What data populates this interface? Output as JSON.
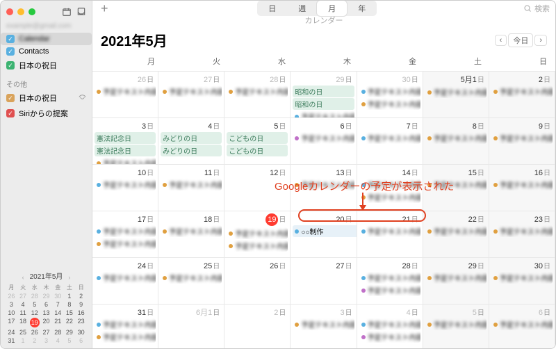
{
  "sidebar": {
    "account_blur": "example@gmail.com",
    "calendars": [
      {
        "name": "",
        "color": "#59b0e0",
        "checked": true,
        "selected": true,
        "blur": true
      },
      {
        "name": "Contacts",
        "color": "#59b0e0",
        "checked": true
      },
      {
        "name": "日本の祝日",
        "color": "#3cb371",
        "checked": true
      }
    ],
    "other_label": "その他",
    "other": [
      {
        "name": "日本の祝日",
        "color": "#d9a35b",
        "checked": true,
        "shared": true
      },
      {
        "name": "Siriからの提案",
        "color": "#e05050",
        "checked": true
      }
    ]
  },
  "toolbar": {
    "segments": [
      "日",
      "週",
      "月",
      "年"
    ],
    "active": 2,
    "search_placeholder": "検索",
    "calendar_label": "カレンダー"
  },
  "header": {
    "month_label": "2021年5月",
    "today_label": "今日"
  },
  "dow": [
    "月",
    "火",
    "水",
    "木",
    "金",
    "土",
    "日"
  ],
  "weeks": [
    [
      {
        "d": "26",
        "sfx": "日",
        "off": true,
        "events": [
          {
            "blur": true,
            "dot": "#e0a040",
            "time": "14:10"
          }
        ]
      },
      {
        "d": "27",
        "sfx": "日",
        "off": true,
        "events": [
          {
            "blur": true,
            "dot": "#e0a040",
            "time": "11:30"
          }
        ]
      },
      {
        "d": "28",
        "sfx": "日",
        "off": true,
        "events": [
          {
            "blur": true,
            "dot": "#e0a040",
            "time": "13:00"
          }
        ]
      },
      {
        "d": "29",
        "sfx": "日",
        "off": true,
        "events": [
          {
            "banner": true,
            "text": "昭和の日"
          },
          {
            "banner": true,
            "text": "昭和の日"
          },
          {
            "blur": true,
            "dot": "#59b0e0",
            "time": "9:00"
          },
          {
            "blur": true,
            "dot": "#e0a040",
            "time": "16:00"
          }
        ]
      },
      {
        "d": "30",
        "sfx": "日",
        "off": true,
        "events": [
          {
            "blur": true,
            "dot": "#59b0e0",
            "time": "14:10"
          },
          {
            "blur": true,
            "dot": "#e0a040",
            "time": "19:00"
          }
        ]
      },
      {
        "d": "5月1",
        "sfx": "日",
        "off": false,
        "events": [
          {
            "blur": true,
            "dot": "#e0a040",
            "time": "19:00"
          }
        ]
      },
      {
        "d": "2",
        "sfx": "日",
        "off": false,
        "events": [
          {
            "blur": true,
            "dot": "#e0a040",
            "time": "19:00"
          }
        ]
      }
    ],
    [
      {
        "d": "3",
        "sfx": "日",
        "events": [
          {
            "banner": true,
            "text": "憲法記念日"
          },
          {
            "banner": true,
            "text": "憲法記念日"
          },
          {
            "blur": true,
            "dot": "#e0a040",
            "time": "11:30"
          }
        ]
      },
      {
        "d": "4",
        "sfx": "日",
        "events": [
          {
            "banner": true,
            "text": "みどりの日"
          },
          {
            "banner": true,
            "text": "みどりの日"
          }
        ]
      },
      {
        "d": "5",
        "sfx": "日",
        "events": [
          {
            "banner": true,
            "text": "こどもの日"
          },
          {
            "banner": true,
            "text": "こどもの日"
          }
        ]
      },
      {
        "d": "6",
        "sfx": "日",
        "events": [
          {
            "blur": true,
            "dot": "#c070c8"
          }
        ]
      },
      {
        "d": "7",
        "sfx": "日",
        "events": [
          {
            "blur": true,
            "dot": "#59b0e0"
          }
        ]
      },
      {
        "d": "8",
        "sfx": "日",
        "events": [
          {
            "blur": true,
            "dot": "#e0a040",
            "time": "15:30"
          }
        ]
      },
      {
        "d": "9",
        "sfx": "日",
        "events": [
          {
            "blur": true,
            "dot": "#e0a040",
            "time": "15:00"
          }
        ]
      }
    ],
    [
      {
        "d": "10",
        "sfx": "日",
        "events": [
          {
            "blur": true,
            "dot": "#59b0e0",
            "time": "13:00"
          }
        ]
      },
      {
        "d": "11",
        "sfx": "日",
        "events": [
          {
            "blur": true,
            "dot": "#e0a040",
            "time": "15:00"
          }
        ]
      },
      {
        "d": "12",
        "sfx": "日",
        "events": []
      },
      {
        "d": "13",
        "sfx": "日",
        "events": [
          {
            "blur": true,
            "dot": "#e0a040",
            "time": "17:40"
          }
        ]
      },
      {
        "d": "14",
        "sfx": "日",
        "events": [
          {
            "blur": true,
            "dot": "#59b0e0",
            "time": "14:10"
          },
          {
            "blur": true,
            "dot": "#e0a040",
            "time": "19:00"
          }
        ]
      },
      {
        "d": "15",
        "sfx": "日",
        "events": [
          {
            "blur": true,
            "dot": "#e0a040",
            "time": "19:00"
          }
        ]
      },
      {
        "d": "16",
        "sfx": "日",
        "events": [
          {
            "blur": true,
            "dot": "#e0a040",
            "time": "15:30"
          }
        ]
      }
    ],
    [
      {
        "d": "17",
        "sfx": "日",
        "events": [
          {
            "blur": true,
            "dot": "#59b0e0",
            "time": "15:00"
          },
          {
            "blur": true,
            "dot": "#e0a040",
            "time": "17:40"
          }
        ]
      },
      {
        "d": "18",
        "sfx": "日",
        "events": [
          {
            "blur": true,
            "dot": "#e0a040",
            "time": "15:00"
          }
        ]
      },
      {
        "d": "19",
        "sfx": "日",
        "today": true,
        "events": [
          {
            "blur": true,
            "dot": "#e0a040",
            "time": "11:00"
          },
          {
            "blur": true,
            "dot": "#e0a040",
            "time": "17:40"
          }
        ]
      },
      {
        "d": "20",
        "sfx": "日",
        "events": [
          {
            "dot": "#59b0e0",
            "text": "○○制作",
            "highlight": true
          }
        ]
      },
      {
        "d": "21",
        "sfx": "日",
        "events": [
          {
            "blur": true,
            "dot": "#59b0e0",
            "time": "14:10"
          }
        ]
      },
      {
        "d": "22",
        "sfx": "日",
        "events": [
          {
            "blur": true,
            "dot": "#e0a040",
            "time": "15:30"
          }
        ]
      },
      {
        "d": "23",
        "sfx": "日",
        "events": [
          {
            "blur": true,
            "dot": "#e0a040",
            "time": "15:00"
          }
        ]
      }
    ],
    [
      {
        "d": "24",
        "sfx": "日",
        "events": [
          {
            "blur": true,
            "dot": "#59b0e0",
            "time": "13:00"
          }
        ]
      },
      {
        "d": "25",
        "sfx": "日",
        "events": [
          {
            "blur": true,
            "dot": "#e0a040",
            "time": "15:00"
          }
        ]
      },
      {
        "d": "26",
        "sfx": "日",
        "events": []
      },
      {
        "d": "27",
        "sfx": "日",
        "events": []
      },
      {
        "d": "28",
        "sfx": "日",
        "events": [
          {
            "blur": true,
            "dot": "#59b0e0",
            "time": "14:10"
          },
          {
            "blur": true,
            "dot": "#c070c8"
          }
        ]
      },
      {
        "d": "29",
        "sfx": "日",
        "events": [
          {
            "blur": true,
            "dot": "#e0a040",
            "time": "19:00"
          }
        ]
      },
      {
        "d": "30",
        "sfx": "日",
        "events": [
          {
            "blur": true,
            "dot": "#e0a040",
            "time": "15:00"
          }
        ]
      }
    ],
    [
      {
        "d": "31",
        "sfx": "日",
        "events": [
          {
            "blur": true,
            "dot": "#59b0e0",
            "time": "13:00"
          },
          {
            "blur": true,
            "dot": "#e0a040"
          }
        ]
      },
      {
        "d": "6月1",
        "sfx": "日",
        "off": true,
        "events": []
      },
      {
        "d": "2",
        "sfx": "日",
        "off": true,
        "events": []
      },
      {
        "d": "3",
        "sfx": "日",
        "off": true,
        "events": [
          {
            "blur": true,
            "dot": "#e0a040"
          }
        ]
      },
      {
        "d": "4",
        "sfx": "日",
        "off": true,
        "events": [
          {
            "blur": true,
            "dot": "#59b0e0"
          },
          {
            "blur": true,
            "dot": "#c070c8"
          }
        ]
      },
      {
        "d": "5",
        "sfx": "日",
        "off": true,
        "events": [
          {
            "blur": true,
            "dot": "#e0a040",
            "time": "15:30"
          }
        ]
      },
      {
        "d": "6",
        "sfx": "日",
        "off": true,
        "events": [
          {
            "blur": true,
            "dot": "#e0a040",
            "time": "15:30"
          }
        ]
      }
    ]
  ],
  "mini": {
    "title": "2021年5月",
    "dow": [
      "月",
      "火",
      "水",
      "木",
      "金",
      "土",
      "日"
    ],
    "rows": [
      [
        "26",
        "27",
        "28",
        "29",
        "30",
        "1",
        "2"
      ],
      [
        "3",
        "4",
        "5",
        "6",
        "7",
        "8",
        "9"
      ],
      [
        "10",
        "11",
        "12",
        "13",
        "14",
        "15",
        "16"
      ],
      [
        "17",
        "18",
        "19",
        "20",
        "21",
        "22",
        "23"
      ],
      [
        "24",
        "25",
        "26",
        "27",
        "28",
        "29",
        "30"
      ],
      [
        "31",
        "1",
        "2",
        "3",
        "4",
        "5",
        "6"
      ]
    ],
    "today": "19"
  },
  "annotation": {
    "text": "Googleカレンダーの予定が表示された"
  }
}
